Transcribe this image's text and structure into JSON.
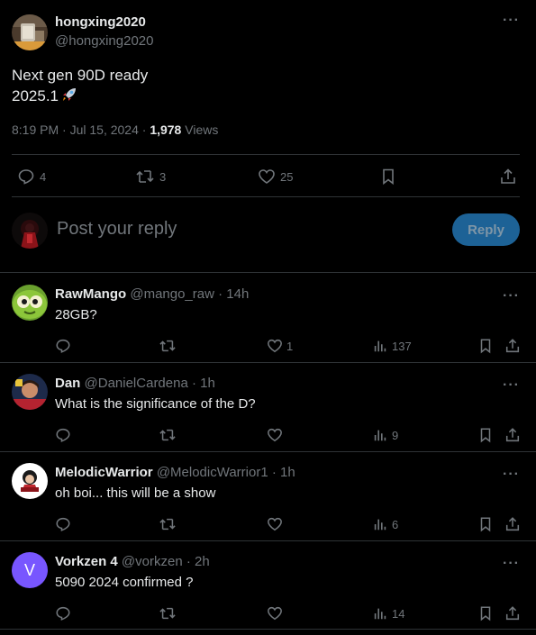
{
  "main_tweet": {
    "author_name": "hongxing2020",
    "author_handle": "@hongxing2020",
    "text_line1": "Next gen 90D ready",
    "text_line2": "2025.1",
    "time": "8:19 PM · Jul 15, 2024 · ",
    "views_count": "1,978",
    "views_label": "Views",
    "replies": "4",
    "reposts": "3",
    "likes": "25"
  },
  "composer": {
    "placeholder": "Post your reply",
    "reply_label": "Reply"
  },
  "replies": [
    {
      "name": "RawMango",
      "handle": "@mango_raw · 14h",
      "text": "28GB?",
      "likes": "1",
      "views": "137"
    },
    {
      "name": "Dan",
      "handle": "@DanielCardena · 1h",
      "text": "What is the significance of the D?",
      "likes": "",
      "views": "9"
    },
    {
      "name": "MelodicWarrior",
      "handle": "@MelodicWarrior1 · 1h",
      "text": "oh boi... this will be a show",
      "likes": "",
      "views": "6"
    },
    {
      "name": "Vorkzen 4",
      "handle": "@vorkzen · 2h",
      "text": "5090 2024 confirmed ?",
      "likes": "",
      "views": "14",
      "avatar_letter": "V"
    }
  ],
  "colors": {
    "background": "#000000",
    "text": "#e7e9ea",
    "muted": "#71767b",
    "border": "#2f3336",
    "reply_button": "#1d6296",
    "avatar_purple": "#7856ff"
  }
}
